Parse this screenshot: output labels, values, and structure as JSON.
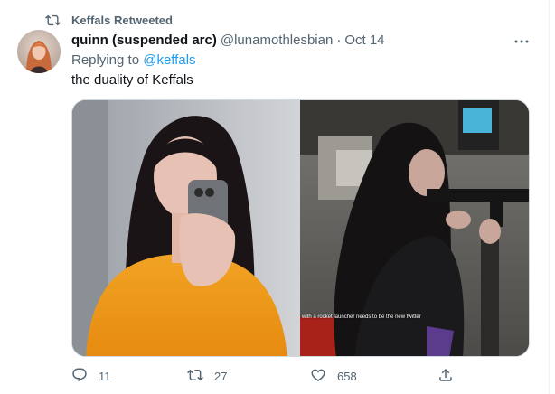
{
  "retweet": {
    "text": "Keffals Retweeted",
    "icon": "retweet-icon"
  },
  "author": {
    "display_name": "quinn (suspended arc)",
    "handle": "@lunamothlesbian",
    "separator": "·",
    "date": "Oct 14"
  },
  "reply": {
    "prefix": "Replying to",
    "mention": "@keffals"
  },
  "tweet_text": "the duality of Keffals",
  "media": {
    "left_image": "selfie-photo",
    "right_image": "shooting-range-photo",
    "caption_overlay": "with a rocket launcher needs to be the new twitter"
  },
  "actions": {
    "reply_count": "11",
    "retweet_count": "27",
    "like_count": "658"
  },
  "colors": {
    "accent": "#1d9bf0",
    "secondary_text": "#536471",
    "primary_text": "#0f1419",
    "border": "#cfd9de"
  }
}
